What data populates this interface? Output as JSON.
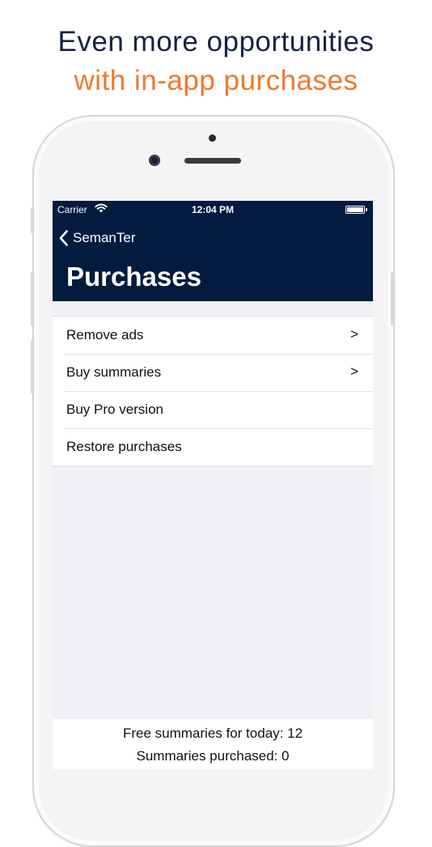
{
  "headline": {
    "line1": "Even more opportunities",
    "line2": "with in-app purchases"
  },
  "status_bar": {
    "carrier": "Carrier",
    "time": "12:04 PM",
    "wifi_icon": "wifi-icon",
    "battery_icon": "battery-icon",
    "battery_level": 1.0
  },
  "nav": {
    "back_label": "SemanTer",
    "back_icon": "chevron-left-icon",
    "title": "Purchases"
  },
  "menu": {
    "items": [
      {
        "label": "Remove ads",
        "accessory": ">"
      },
      {
        "label": "Buy summaries",
        "accessory": ">"
      },
      {
        "label": "Buy Pro version",
        "accessory": ""
      },
      {
        "label": "Restore purchases",
        "accessory": ""
      }
    ]
  },
  "footer": {
    "free_label": "Free summaries for today:",
    "free_value": "12",
    "purchased_label": "Summaries purchased:",
    "purchased_value": "0"
  },
  "colors": {
    "navbar": "#021b3f",
    "headline_primary": "#152346",
    "headline_accent": "#f0782d",
    "background": "#efeff4"
  }
}
